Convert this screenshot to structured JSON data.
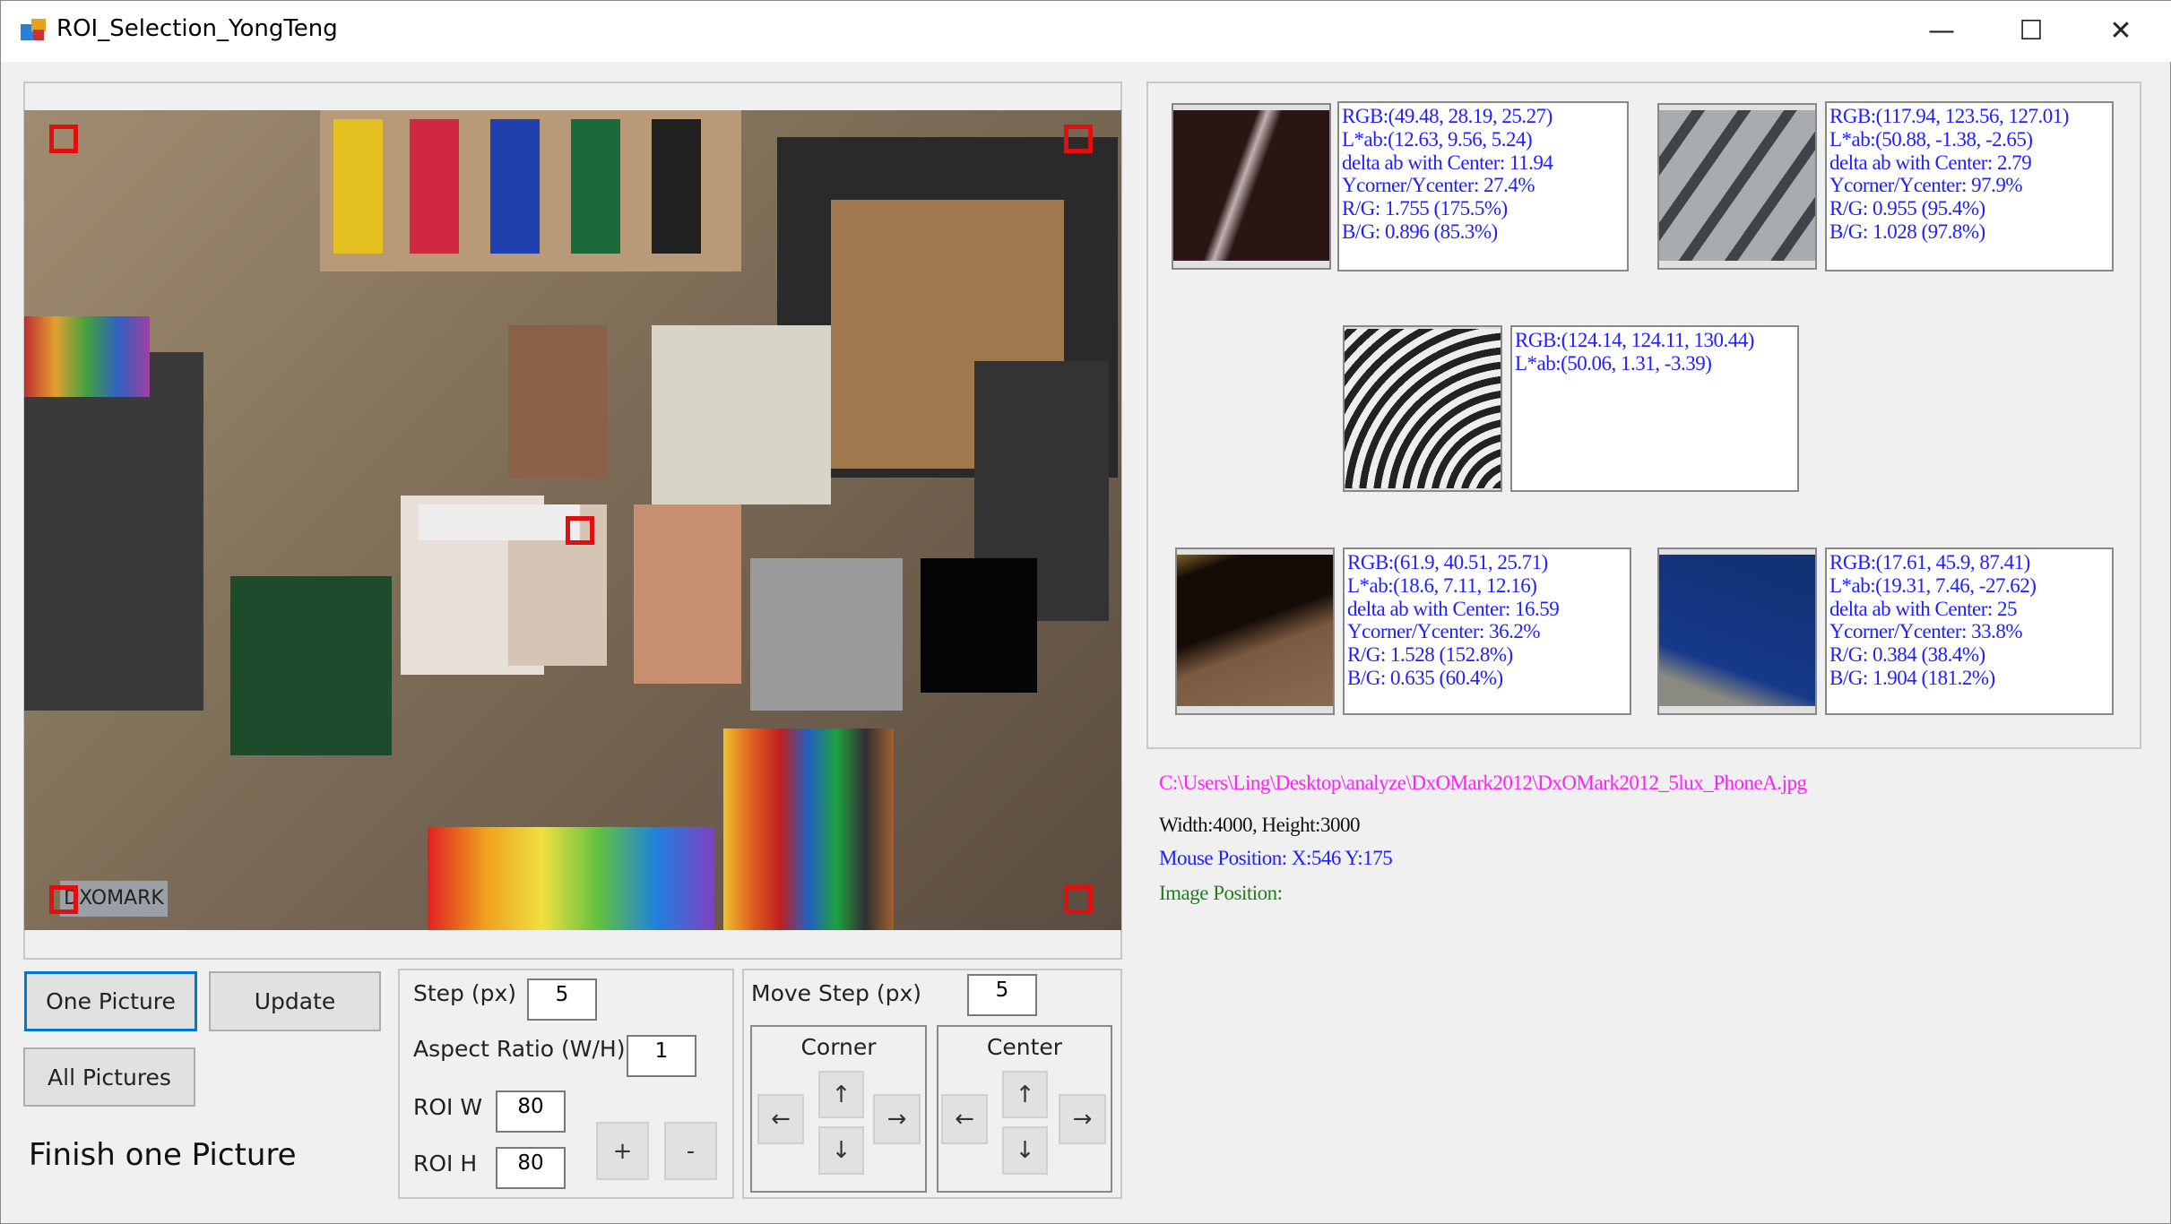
{
  "window": {
    "title": "ROI_Selection_YongTeng",
    "minimize": "—",
    "maximize": "☐",
    "close": "✕"
  },
  "image": {
    "watermark": "DXOMARK"
  },
  "rois": [
    {
      "rgb": "RGB:(49.48, 28.19, 25.27)",
      "lab": "L*ab:(12.63, 9.56, 5.24)",
      "delta": "delta ab with Center: 11.94",
      "ratio": "Ycorner/Ycenter: 27.4%",
      "rg": "R/G: 1.755 (175.5%)",
      "bg": "B/G: 0.896 (85.3%)"
    },
    {
      "rgb": "RGB:(117.94, 123.56, 127.01)",
      "lab": "L*ab:(50.88, -1.38, -2.65)",
      "delta": "delta ab with Center: 2.79",
      "ratio": "Ycorner/Ycenter: 97.9%",
      "rg": "R/G: 0.955 (95.4%)",
      "bg": "B/G: 1.028 (97.8%)"
    },
    {
      "rgb": "RGB:(124.14, 124.11, 130.44)",
      "lab": "L*ab:(50.06, 1.31, -3.39)"
    },
    {
      "rgb": "RGB:(61.9, 40.51, 25.71)",
      "lab": "L*ab:(18.6, 7.11, 12.16)",
      "delta": "delta ab with Center: 16.59",
      "ratio": "Ycorner/Ycenter: 36.2%",
      "rg": "R/G: 1.528 (152.8%)",
      "bg": "B/G: 0.635 (60.4%)"
    },
    {
      "rgb": "RGB:(17.61, 45.9, 87.41)",
      "lab": "L*ab:(19.31, 7.46, -27.62)",
      "delta": "delta ab with Center: 25",
      "ratio": "Ycorner/Ycenter: 33.8%",
      "rg": "R/G: 0.384 (38.4%)",
      "bg": "B/G: 1.904 (181.2%)"
    }
  ],
  "status": {
    "path": "C:\\Users\\Ling\\Desktop\\analyze\\DxOMark2012\\DxOMark2012_5lux_PhoneA.jpg",
    "size": "Width:4000, Height:3000",
    "mouse": "Mouse Position: X:546  Y:175",
    "image_position": "Image Position:"
  },
  "buttons": {
    "one_picture": "One Picture",
    "update": "Update",
    "all_pictures": "All Pictures"
  },
  "message": "Finish one Picture",
  "roi_settings": {
    "step_label": "Step (px)",
    "step": "5",
    "aspect_label": "Aspect Ratio (W/H)",
    "aspect": "1",
    "w_label": "ROI W",
    "w": "80",
    "h_label": "ROI H",
    "h": "80",
    "plus": "+",
    "minus": "-"
  },
  "move": {
    "label": "Move Step (px)",
    "step": "5",
    "corner": "Corner",
    "center": "Center",
    "left": "←",
    "up": "↑",
    "down": "↓",
    "right": "→"
  }
}
